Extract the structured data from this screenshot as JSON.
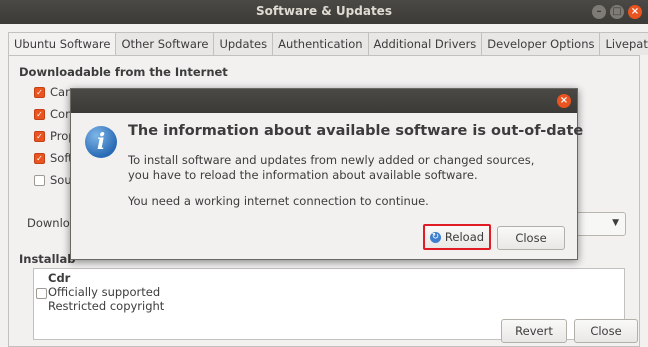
{
  "window": {
    "title": "Software & Updates",
    "minimize": "–",
    "maximize": "□",
    "close": "×"
  },
  "tabs": [
    "Ubuntu Software",
    "Other Software",
    "Updates",
    "Authentication",
    "Additional Drivers",
    "Developer Options",
    "Livepatch"
  ],
  "downloadable": {
    "heading": "Downloadable from the Internet",
    "items": [
      {
        "label": "Canonical-supported free and open-source software (main)",
        "visible": "Canc",
        "checked": true
      },
      {
        "label": "Com",
        "checked": true
      },
      {
        "label": "Prop",
        "checked": true
      },
      {
        "label": "Soft",
        "checked": true
      },
      {
        "label": "Sour",
        "checked": false
      }
    ],
    "download_from_label": "Downlo"
  },
  "installable": {
    "heading": "Installab",
    "cdrom_title": "Cdr",
    "lines": [
      "Officially supported",
      "Restricted copyright"
    ]
  },
  "buttons": {
    "revert": "Revert",
    "close": "Close"
  },
  "dialog": {
    "close": "×",
    "icon": "i",
    "title": "The information about available software is out-of-date",
    "message": "To install software and updates from newly added or changed sources, you have to reload the information about available software.",
    "note": "You need a working internet connection to continue.",
    "reload": "Reload",
    "close_button": "Close"
  },
  "colors": {
    "accent": "#e95420",
    "highlight": "#e01b24",
    "titlebar": "#3b3a36"
  }
}
